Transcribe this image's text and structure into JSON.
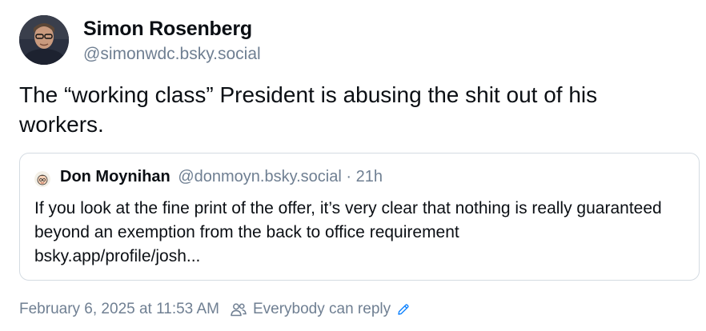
{
  "post": {
    "author": {
      "display_name": "Simon Rosenberg",
      "handle": "@simonwdc.bsky.social"
    },
    "text": "The “working class” President is abusing the shit out of his workers.",
    "quote": {
      "author_name": "Don Moynihan",
      "author_handle": "@donmoyn.bsky.social",
      "separator": "·",
      "time": "21h",
      "text_line1": "If you look at the fine print of the offer, it’s very clear that nothing is really guaranteed beyond an exemption from the back to office requirement",
      "text_line2": "bsky.app/profile/josh..."
    },
    "meta": {
      "timestamp": "February 6, 2025 at 11:53 AM",
      "reply_setting": "Everybody can reply",
      "people_icon": "people-icon",
      "edit_icon": "pencil-icon"
    }
  },
  "colors": {
    "text_primary": "#0b0f14",
    "text_muted": "#6f7f92",
    "border": "#d4dbe2",
    "link_accent": "#1083fe"
  }
}
